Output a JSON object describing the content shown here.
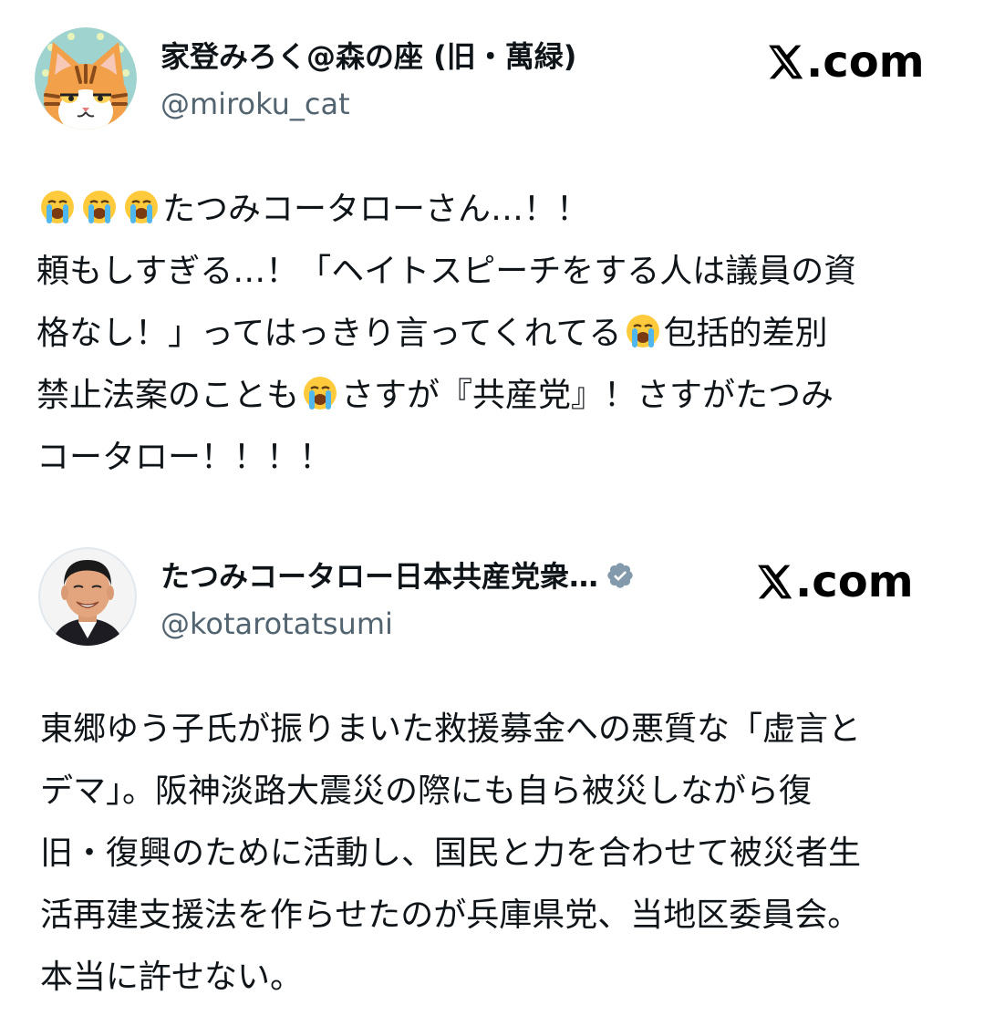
{
  "tweets": [
    {
      "display_name": "家登みろく@森の座 (旧・萬緑)",
      "handle": "@miroku_cat",
      "source": ".com",
      "avatar": "cat-avatar",
      "lines": [
        "たつみコータローさん…！！",
        "頼もしすぎる…！「ヘイトスピーチをする人は議員の資",
        "格なし！」ってはっきり言ってくれてる",
        "包括的差別",
        "禁止法案のことも",
        "さすが『共産党』！さすがたつみ",
        "コータロー！！！！"
      ],
      "emoji": "loudly-crying-face"
    },
    {
      "display_name": "たつみコータロー日本共産党衆…",
      "handle": "@kotarotatsumi",
      "source": ".com",
      "verified": true,
      "avatar": "person-avatar",
      "lines": [
        "東郷ゆう子氏が振りまいた救援募金への悪質な「虚言と",
        "デマ」。阪神淡路大震災の際にも自ら被災しながら復",
        "旧・復興のために活動し、国民と力を合わせて被災者生",
        "活再建支援法を作らせたのが兵庫県党、当地区委員会。",
        "本当に許せない。"
      ]
    }
  ],
  "colors": {
    "text": "#0f1419",
    "handle": "#536471",
    "verified": "#829aab"
  }
}
